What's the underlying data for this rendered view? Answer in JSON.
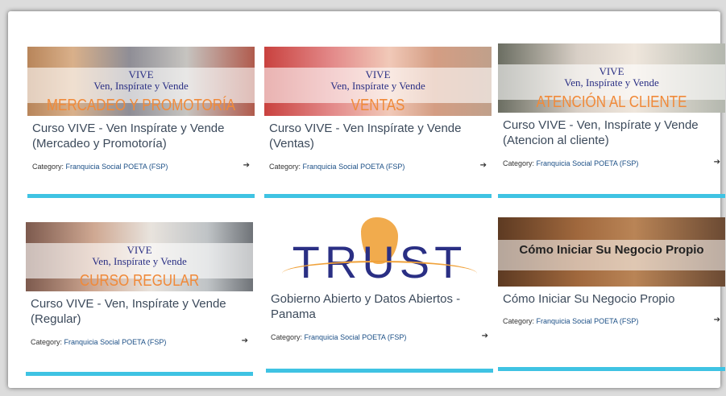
{
  "cards": [
    {
      "thumb": {
        "vive": "VIVE",
        "tagline": "Ven, Inspírate y Vende",
        "big": "MERCADEO Y PROMOTORÍA"
      },
      "title": "Curso VIVE - Ven Inspírate y Vende (Mercadeo y Promotoría)",
      "category_label": "Category:",
      "category_link": "Franquicia Social POETA (FSP)",
      "enter_icon": "enter-icon"
    },
    {
      "thumb": {
        "vive": "VIVE",
        "tagline": "Ven, Inspírate y Vende",
        "big": "VENTAS"
      },
      "title": "Curso VIVE - Ven Inspírate y Vende (Ventas)",
      "category_label": "Category:",
      "category_link": "Franquicia Social POETA (FSP)",
      "enter_icon": "enter-icon"
    },
    {
      "thumb": {
        "vive": "VIVE",
        "tagline": "Ven, Inspírate y Vende",
        "big": "ATENCIÓN AL CLIENTE"
      },
      "title": "Curso VIVE - Ven, Inspírate y Vende (Atencion al cliente)",
      "category_label": "Category:",
      "category_link": "Franquicia Social POETA (FSP)",
      "enter_icon": "enter-icon"
    },
    {
      "thumb": {
        "vive": "VIVE",
        "tagline": "Ven, Inspírate y Vende",
        "big": "CURSO REGULAR"
      },
      "title": "Curso VIVE - Ven, Inspírate y Vende (Regular)",
      "category_label": "Category:",
      "category_link": "Franquicia Social POETA (FSP)",
      "enter_icon": "enter-icon"
    },
    {
      "thumb": {
        "logo": "TRUST"
      },
      "title": "Gobierno Abierto y Datos Abiertos - Panama",
      "category_label": "Category:",
      "category_link": "Franquicia Social POETA (FSP)",
      "enter_icon": "enter-icon"
    },
    {
      "thumb": {
        "overlay": "Cómo Iniciar Su Negocio Propio"
      },
      "title": "Cómo Iniciar Su Negocio Propio",
      "category_label": "Category:",
      "category_link": "Franquicia Social POETA (FSP)",
      "enter_icon": "enter-icon"
    }
  ],
  "colors": {
    "accent_bar": "#3fc3e3",
    "title_text": "#3c4a5b",
    "vive_blue": "#2a2f84",
    "vive_orange": "#f08a3a"
  }
}
